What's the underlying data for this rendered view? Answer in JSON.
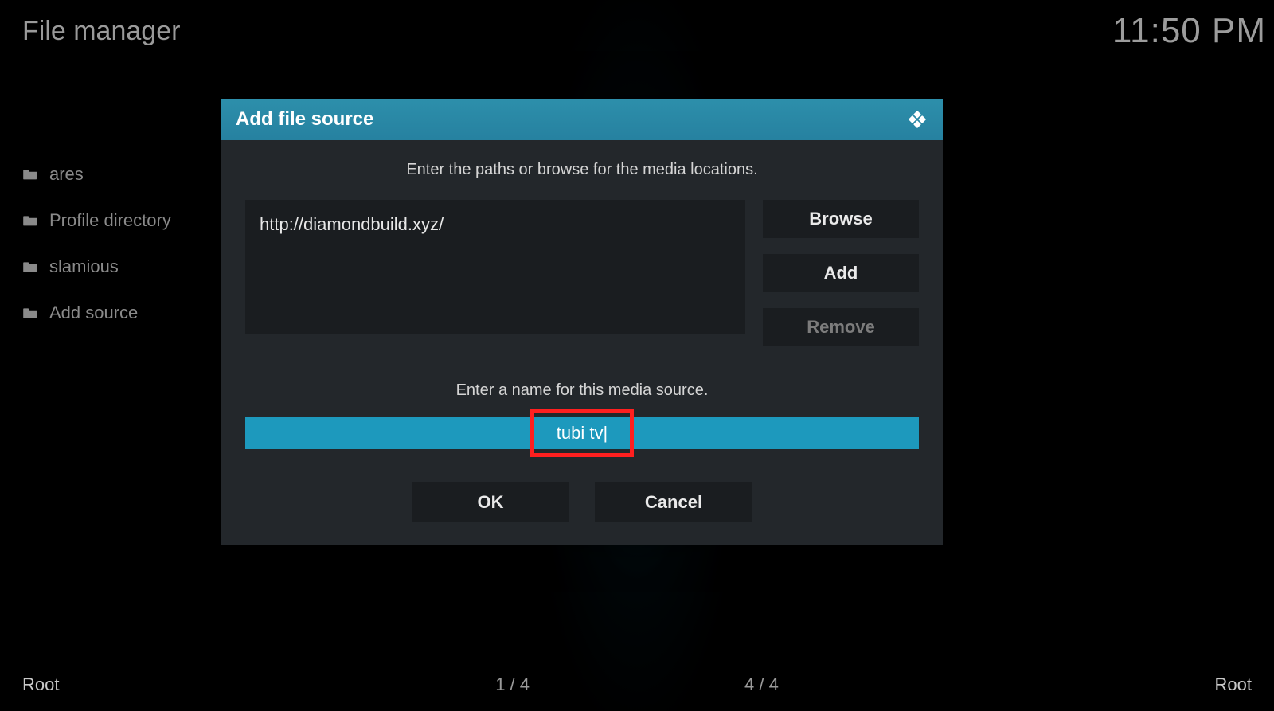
{
  "header": {
    "title": "File manager",
    "clock": "11:50 PM"
  },
  "sidebar": {
    "items": [
      {
        "label": "ares"
      },
      {
        "label": "Profile directory"
      },
      {
        "label": "slamious"
      },
      {
        "label": "Add source"
      }
    ]
  },
  "footer": {
    "left_root": "Root",
    "right_root": "Root",
    "left_count": "1 / 4",
    "right_count": "4 / 4"
  },
  "dialog": {
    "title": "Add file source",
    "hint_paths": "Enter the paths or browse for the media locations.",
    "path_value": "http://diamondbuild.xyz/",
    "browse_label": "Browse",
    "add_label": "Add",
    "remove_label": "Remove",
    "hint_name": "Enter a name for this media source.",
    "name_value": "tubi tv",
    "ok_label": "OK",
    "cancel_label": "Cancel"
  },
  "icons": {
    "folder": "folder-icon",
    "kodi": "kodi-logo-icon"
  }
}
